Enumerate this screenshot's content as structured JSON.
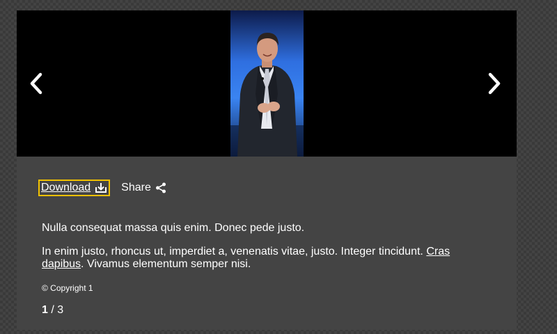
{
  "gallery": {
    "prev_label": "Previous",
    "next_label": "Next",
    "photo_alt": "Man in a dark suit speaking on stage"
  },
  "actions": {
    "download_label": "Download",
    "share_label": "Share"
  },
  "caption": {
    "paragraph1": "Nulla consequat massa quis enim. Donec pede justo.",
    "paragraph2_before": "In enim justo, rhoncus ut, imperdiet a, venenatis vitae, justo. Integer tincidunt.",
    "paragraph2_link": "Cras dapibus",
    "paragraph2_after": ". Vivamus elementum semper nisi."
  },
  "copyright": "© Copyright 1",
  "counter": {
    "current": "1",
    "separator": " / ",
    "total": "3"
  },
  "colors": {
    "focus_outline": "#f2c200",
    "panel_bg": "#444444",
    "stage_bg": "#000000"
  }
}
